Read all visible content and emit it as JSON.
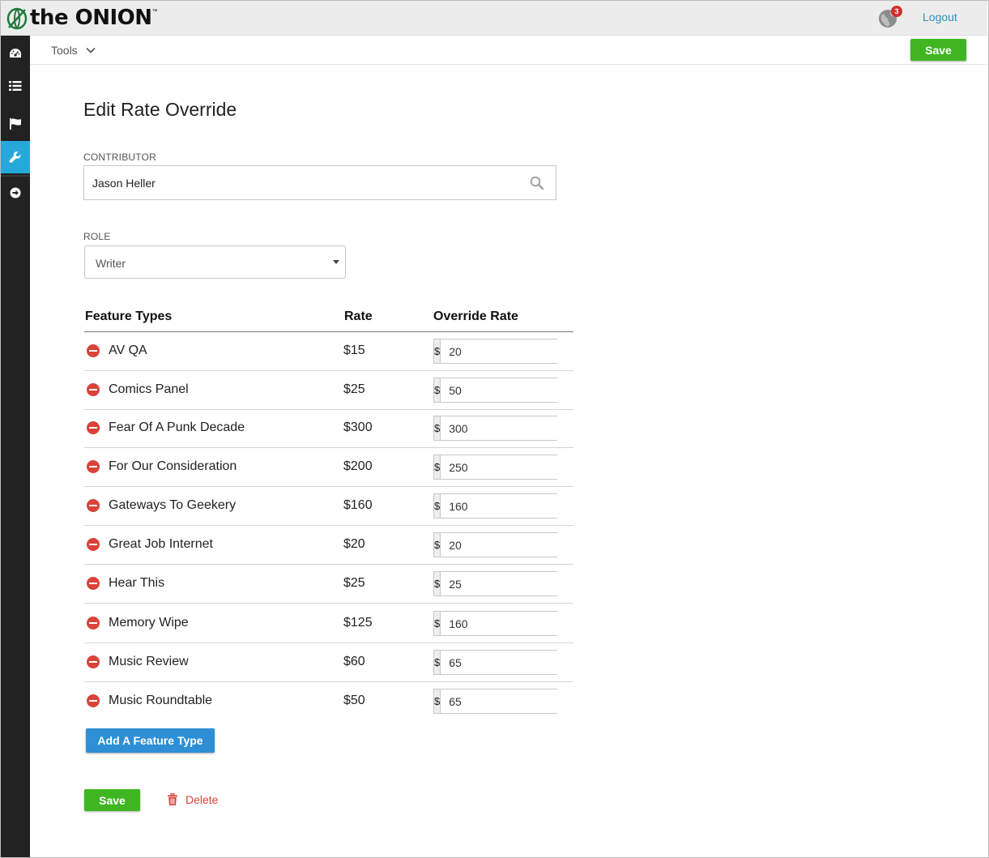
{
  "header": {
    "logo_text": "the ONION",
    "logo_tm": "™",
    "notification_count": "3",
    "logout_label": "Logout"
  },
  "sidebar": {
    "items": [
      {
        "icon": "dashboard-icon"
      },
      {
        "icon": "list-icon"
      },
      {
        "icon": "flag-icon"
      },
      {
        "icon": "wrench-icon",
        "active": true
      },
      {
        "icon": "sign-out-icon"
      }
    ]
  },
  "toolbar": {
    "tools_label": "Tools",
    "save_label": "Save"
  },
  "form": {
    "title": "Edit Rate Override",
    "contributor_label": "CONTRIBUTOR",
    "contributor_value": "Jason Heller",
    "role_label": "ROLE",
    "role_value": "Writer"
  },
  "table": {
    "headers": {
      "feature_types": "Feature Types",
      "rate": "Rate",
      "override_rate": "Override Rate"
    },
    "currency_symbol": "$",
    "rows": [
      {
        "name": "AV QA",
        "rate": "$15",
        "override": "20"
      },
      {
        "name": "Comics Panel",
        "rate": "$25",
        "override": "50"
      },
      {
        "name": "Fear Of A Punk Decade",
        "rate": "$300",
        "override": "300"
      },
      {
        "name": "For Our Consideration",
        "rate": "$200",
        "override": "250"
      },
      {
        "name": "Gateways To Geekery",
        "rate": "$160",
        "override": "160"
      },
      {
        "name": "Great Job Internet",
        "rate": "$20",
        "override": "20"
      },
      {
        "name": "Hear This",
        "rate": "$25",
        "override": "25"
      },
      {
        "name": "Memory Wipe",
        "rate": "$125",
        "override": "160"
      },
      {
        "name": "Music Review",
        "rate": "$60",
        "override": "65"
      },
      {
        "name": "Music Roundtable",
        "rate": "$50",
        "override": "65"
      }
    ]
  },
  "actions": {
    "add_feature_label": "Add A Feature Type",
    "save_label": "Save",
    "delete_label": "Delete"
  },
  "colors": {
    "save_green": "#3fb621",
    "add_blue": "#2e8fd6",
    "delete_red": "#d9433a",
    "sidebar_bg": "#222222",
    "sidebar_active": "#26a9d8",
    "link_blue": "#2a8fbd"
  }
}
